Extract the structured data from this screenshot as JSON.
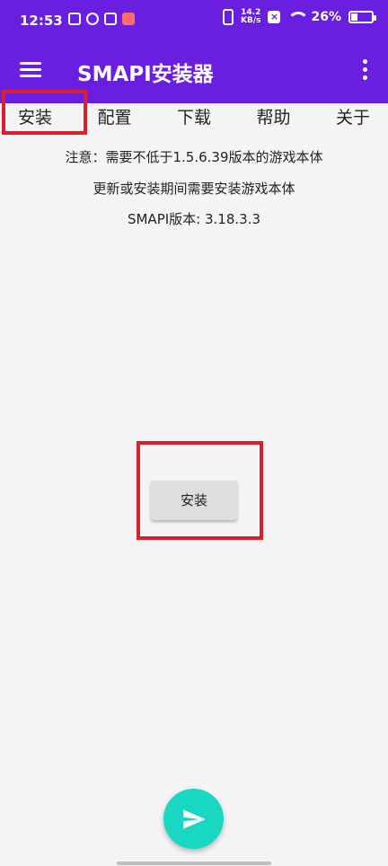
{
  "status_bar": {
    "time": "12:53",
    "network_speed": "14.2\nKB/s",
    "battery_percent": "26%",
    "icons": [
      "notification-icon",
      "cloud-icon",
      "app-icon",
      "red-app-icon",
      "vibrate-icon",
      "sim-off-icon",
      "wifi-icon",
      "battery-icon"
    ]
  },
  "app_bar": {
    "title": "SMAPI安装器",
    "menu_icon": "hamburger-menu-icon",
    "more_icon": "more-vert-icon"
  },
  "tabs": [
    {
      "label": "安装"
    },
    {
      "label": "配置"
    },
    {
      "label": "下载"
    },
    {
      "label": "帮助"
    },
    {
      "label": "关于"
    }
  ],
  "notes": {
    "line1": "注意：需要不低于1.5.6.39版本的游戏本体",
    "line2": "更新或安装期间需要安装游戏本体",
    "line3": "SMAPI版本: 3.18.3.3"
  },
  "main": {
    "install_button_label": "安装"
  },
  "fab": {
    "icon": "send-icon"
  },
  "colors": {
    "primary": "#6a1fe0",
    "accent": "#19d8c3",
    "highlight": "#d9212c",
    "background": "#f4f4f4"
  }
}
